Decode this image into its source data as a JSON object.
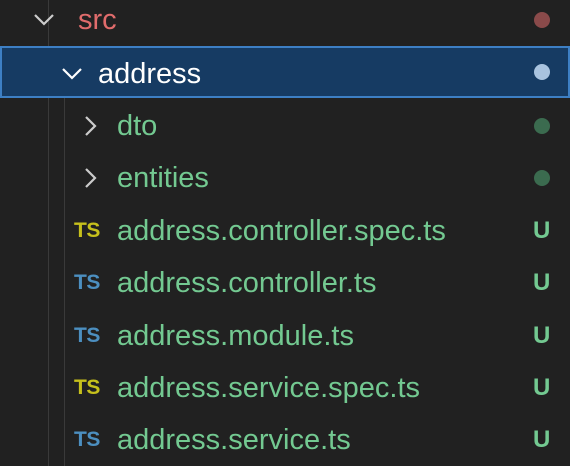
{
  "explorer": {
    "colors": {
      "folder_src": "#e06c6c",
      "selected_label": "#ffffff",
      "untracked": "#73c991",
      "chevron": "#cccccc",
      "selected_chevron": "#ffffff",
      "dot_src": "#8a4a4a",
      "dot_selected": "#a9c3df",
      "dot_green": "#3b6b4f",
      "ts_spec": "#c6c01c",
      "ts_plain": "#4c8fc0"
    },
    "src": {
      "label": "src",
      "icon": "chevron-down-icon"
    },
    "address": {
      "label": "address",
      "icon": "chevron-down-icon"
    },
    "folders": [
      {
        "label": "dto",
        "icon": "chevron-right-icon"
      },
      {
        "label": "entities",
        "icon": "chevron-right-icon"
      }
    ],
    "files": [
      {
        "icon_text": "TS",
        "label": "address.controller.spec.ts",
        "status": "U"
      },
      {
        "icon_text": "TS",
        "label": "address.controller.ts",
        "status": "U"
      },
      {
        "icon_text": "TS",
        "label": "address.module.ts",
        "status": "U"
      },
      {
        "icon_text": "TS",
        "label": "address.service.spec.ts",
        "status": "U"
      },
      {
        "icon_text": "TS",
        "label": "address.service.ts",
        "status": "U"
      }
    ]
  }
}
